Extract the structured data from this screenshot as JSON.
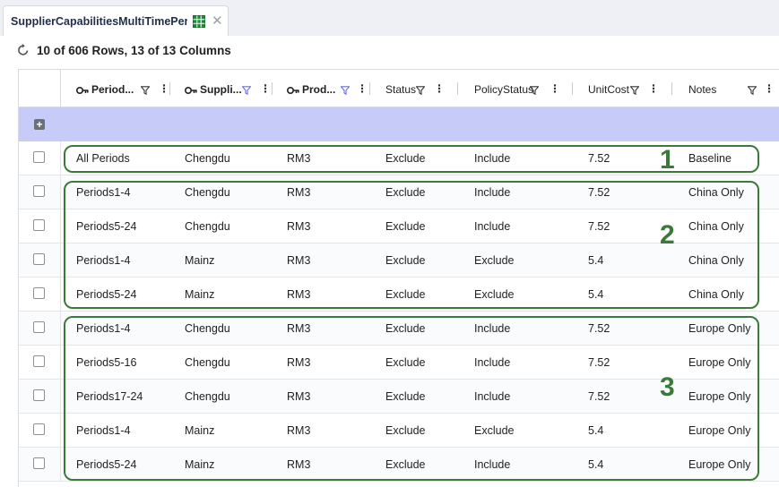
{
  "tab": {
    "title": "SupplierCapabilitiesMultiTimePeriods",
    "sheet_icon": "spreadsheet-icon",
    "close_icon": "close-icon"
  },
  "toolbar": {
    "row_count_text": "10 of 606 Rows, 13 of 13 Columns",
    "refresh_icon": "refresh-icon"
  },
  "columns": [
    {
      "label": "Period...",
      "key": true,
      "filter_active": false
    },
    {
      "label": "Suppli...",
      "key": true,
      "filter_active": true
    },
    {
      "label": "Prod...",
      "key": true,
      "filter_active": true
    },
    {
      "label": "Status",
      "key": false,
      "filter_active": false
    },
    {
      "label": "PolicyStatus",
      "key": false,
      "filter_active": false
    },
    {
      "label": "UnitCost",
      "key": false,
      "filter_active": false
    },
    {
      "label": "Notes",
      "key": false,
      "filter_active": false
    }
  ],
  "rows": [
    [
      "All Periods",
      "Chengdu",
      "RM3",
      "Exclude",
      "Include",
      "7.52",
      "Baseline"
    ],
    [
      "Periods1-4",
      "Chengdu",
      "RM3",
      "Exclude",
      "Include",
      "7.52",
      "China Only"
    ],
    [
      "Periods5-24",
      "Chengdu",
      "RM3",
      "Exclude",
      "Include",
      "7.52",
      "China Only"
    ],
    [
      "Periods1-4",
      "Mainz",
      "RM3",
      "Exclude",
      "Exclude",
      "5.4",
      "China Only"
    ],
    [
      "Periods5-24",
      "Mainz",
      "RM3",
      "Exclude",
      "Exclude",
      "5.4",
      "China Only"
    ],
    [
      "Periods1-4",
      "Chengdu",
      "RM3",
      "Exclude",
      "Include",
      "7.52",
      "Europe Only"
    ],
    [
      "Periods5-16",
      "Chengdu",
      "RM3",
      "Exclude",
      "Include",
      "7.52",
      "Europe Only"
    ],
    [
      "Periods17-24",
      "Chengdu",
      "RM3",
      "Exclude",
      "Include",
      "7.52",
      "Europe Only"
    ],
    [
      "Periods1-4",
      "Mainz",
      "RM3",
      "Exclude",
      "Exclude",
      "5.4",
      "Europe Only"
    ],
    [
      "Periods5-24",
      "Mainz",
      "RM3",
      "Exclude",
      "Include",
      "5.4",
      "Europe Only"
    ]
  ],
  "groups": [
    {
      "label": "1",
      "first_row": 0,
      "last_row": 0
    },
    {
      "label": "2",
      "first_row": 1,
      "last_row": 4
    },
    {
      "label": "3",
      "first_row": 5,
      "last_row": 9
    }
  ],
  "colors": {
    "accent": "#c6cbf7",
    "group_outline": "#3c7a3c",
    "filter_active": "#6a6fd6"
  }
}
